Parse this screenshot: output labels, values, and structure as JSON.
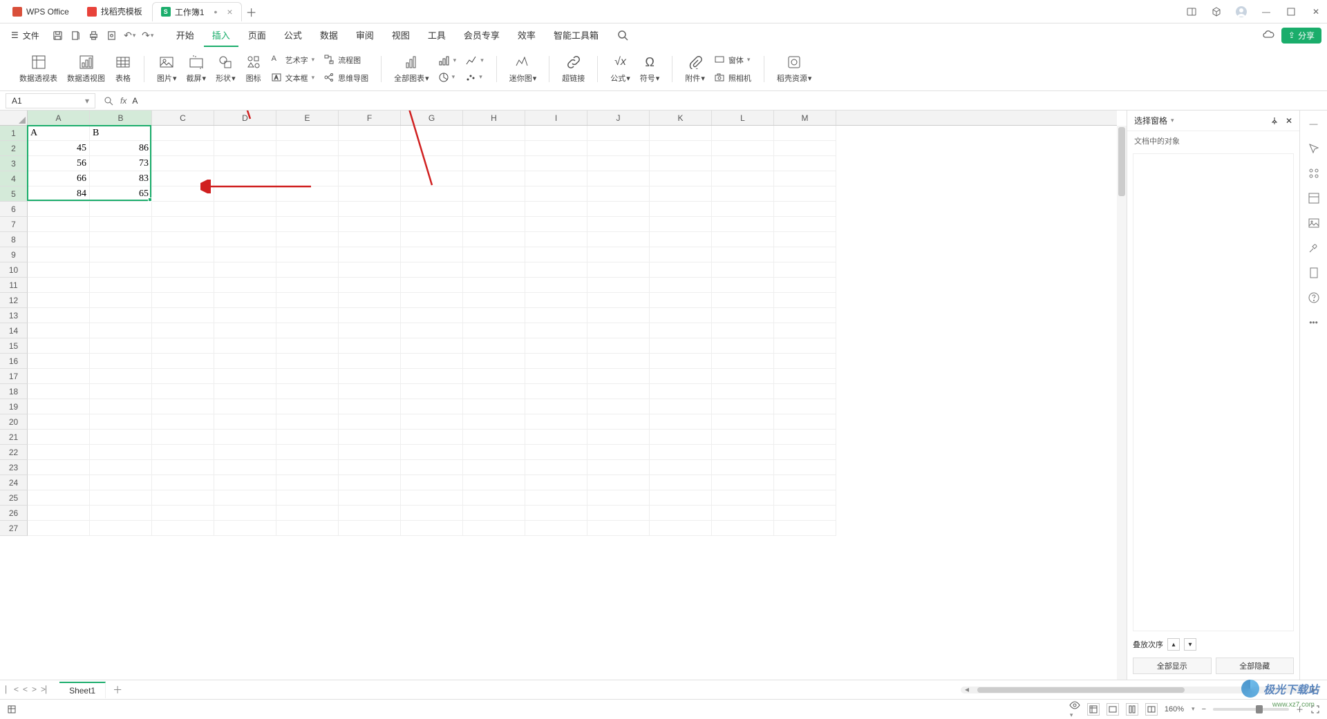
{
  "tabs": [
    {
      "label": "WPS Office",
      "icon": "wps"
    },
    {
      "label": "找稻壳模板",
      "icon": "docer"
    },
    {
      "label": "工作簿1",
      "icon": "sheet",
      "active": true,
      "dirty": true
    }
  ],
  "file_menu": "文件",
  "menu_tabs": [
    "开始",
    "插入",
    "页面",
    "公式",
    "数据",
    "审阅",
    "视图",
    "工具",
    "会员专享",
    "效率",
    "智能工具箱"
  ],
  "active_menu_tab": "插入",
  "share_label": "分享",
  "ribbon": {
    "pivot_table": "数据透视表",
    "pivot_chart": "数据透视图",
    "table": "表格",
    "picture": "图片",
    "screenshot": "截屏",
    "shapes": "形状",
    "icons": "图标",
    "wordart": "艺术字",
    "textbox": "文本框",
    "flowchart": "流程图",
    "mindmap": "思维导图",
    "all_charts": "全部图表",
    "sparkline": "迷你图",
    "hyperlink": "超链接",
    "formula": "公式",
    "symbol": "符号",
    "attachment": "附件",
    "camera": "照相机",
    "window": "窗体",
    "resource": "稻壳资源"
  },
  "name_box": "A1",
  "formula_value": "A",
  "columns": [
    "A",
    "B",
    "C",
    "D",
    "E",
    "F",
    "G",
    "H",
    "I",
    "J",
    "K",
    "L",
    "M"
  ],
  "rows": 27,
  "data": [
    [
      "A",
      "B"
    ],
    [
      45,
      86
    ],
    [
      56,
      73
    ],
    [
      66,
      83
    ],
    [
      84,
      65
    ]
  ],
  "selection": {
    "r1": 1,
    "c1": 1,
    "r2": 5,
    "c2": 2
  },
  "right_panel": {
    "title": "选择窗格",
    "subtitle": "文档中的对象",
    "stack_order": "叠放次序",
    "show_all": "全部显示",
    "hide_all": "全部隐藏"
  },
  "sheet_tabs": [
    "Sheet1"
  ],
  "status": {
    "zoom": "160%"
  },
  "watermark": {
    "main": "极光下载站",
    "sub": "www.xz7.com"
  }
}
